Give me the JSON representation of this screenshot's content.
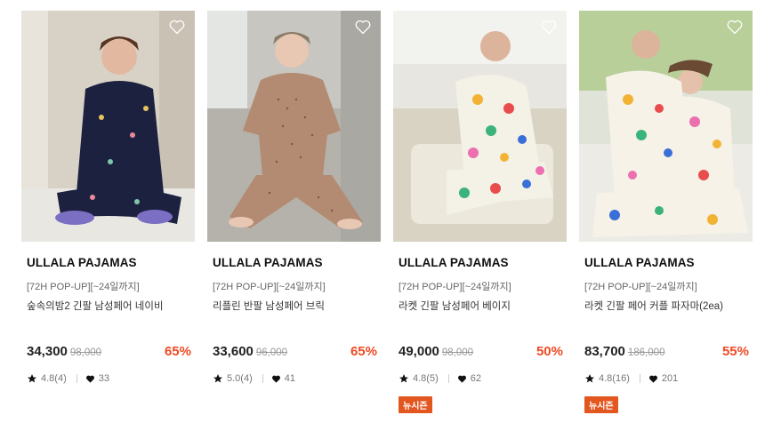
{
  "products": [
    {
      "brand": "ULLALA PAJAMAS",
      "promo": "[72H POP-UP][~24일까지]",
      "name": "숲속의밤2 긴팔 남성페어 네이비",
      "price": "34,300",
      "original_price": "98,000",
      "discount": "65%",
      "rating": "4.8(4)",
      "likes": "33",
      "badge": "",
      "image_icon": "photo-model-navy-longsleeve"
    },
    {
      "brand": "ULLALA PAJAMAS",
      "promo": "[72H POP-UP][~24일까지]",
      "name": "리플린 반팔 남성페어 브릭",
      "price": "33,600",
      "original_price": "96,000",
      "discount": "65%",
      "rating": "5.0(4)",
      "likes": "41",
      "badge": "",
      "image_icon": "photo-model-brick-shortsleeve"
    },
    {
      "brand": "ULLALA PAJAMAS",
      "promo": "[72H POP-UP][~24일까지]",
      "name": "라켓 긴팔 남성페어 베이지",
      "price": "49,000",
      "original_price": "98,000",
      "discount": "50%",
      "rating": "4.8(5)",
      "likes": "62",
      "badge": "뉴시즌",
      "image_icon": "photo-model-colorful-longsleeve"
    },
    {
      "brand": "ULLALA PAJAMAS",
      "promo": "[72H POP-UP][~24일까지]",
      "name": "라켓 긴팔 페어 커플 파자마(2ea)",
      "price": "83,700",
      "original_price": "186,000",
      "discount": "55%",
      "rating": "4.8(16)",
      "likes": "201",
      "badge": "뉴시즌",
      "image_icon": "photo-couple-colorful"
    }
  ],
  "colors": {
    "discount": "#ef4a23",
    "badge_bg": "#e2561f"
  }
}
